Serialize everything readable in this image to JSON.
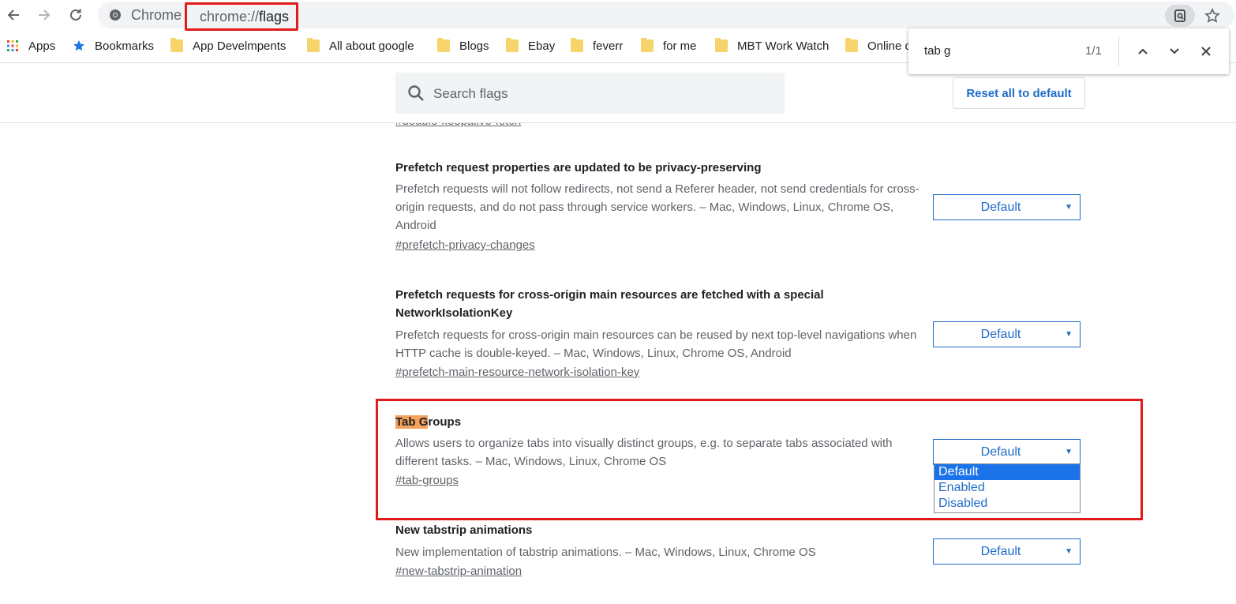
{
  "browser": {
    "site_name": "Chrome",
    "url_scheme": "chrome://",
    "url_path": "flags"
  },
  "bookmarks": [
    {
      "label": "Apps",
      "icon": "apps-grid-icon"
    },
    {
      "label": "Bookmarks",
      "icon": "star-icon"
    },
    {
      "label": "App Develmpents",
      "icon": "folder-icon"
    },
    {
      "label": "All about google",
      "icon": "folder-icon"
    },
    {
      "label": "Blogs",
      "icon": "folder-icon"
    },
    {
      "label": "Ebay",
      "icon": "folder-icon"
    },
    {
      "label": "feverr",
      "icon": "folder-icon"
    },
    {
      "label": "for me",
      "icon": "folder-icon"
    },
    {
      "label": "MBT Work Watch",
      "icon": "folder-icon"
    },
    {
      "label": "Online c",
      "icon": "folder-icon"
    }
  ],
  "find_bar": {
    "query": "tab g",
    "count": "1/1"
  },
  "flags_header": {
    "search_placeholder": "Search flags",
    "reset_label": "Reset all to default"
  },
  "partial_link": "#double-keepalive-fetch",
  "flags": [
    {
      "title": "Prefetch request properties are updated to be privacy-preserving",
      "description": "Prefetch requests will not follow redirects, not send a Referer header, not send credentials for cross-origin requests, and do not pass through service workers. – Mac, Windows, Linux, Chrome OS, Android",
      "link": "#prefetch-privacy-changes",
      "value": "Default"
    },
    {
      "title": "Prefetch requests for cross-origin main resources are fetched with a special NetworkIsolationKey",
      "description": "Prefetch requests for cross-origin main resources can be reused by next top-level navigations when HTTP cache is double-keyed. – Mac, Windows, Linux, Chrome OS, Android",
      "link": "#prefetch-main-resource-network-isolation-key",
      "value": "Default"
    },
    {
      "title_highlight": "Tab G",
      "title_rest": "roups",
      "description": "Allows users to organize tabs into visually distinct groups, e.g. to separate tabs associated with different tasks. – Mac, Windows, Linux, Chrome OS",
      "link": "#tab-groups",
      "value": "Default",
      "options": [
        "Default",
        "Enabled",
        "Disabled"
      ],
      "selected_option": "Default"
    },
    {
      "title": "New tabstrip animations",
      "description": "New implementation of tabstrip animations. – Mac, Windows, Linux, Chrome OS",
      "link": "#new-tabstrip-animation",
      "value": "Default"
    }
  ],
  "colors": {
    "accent": "#1f6cc7",
    "annotation_red": "#e01b1b",
    "find_highlight": "#f3a15b",
    "selected_option_bg": "#1a73e8"
  }
}
